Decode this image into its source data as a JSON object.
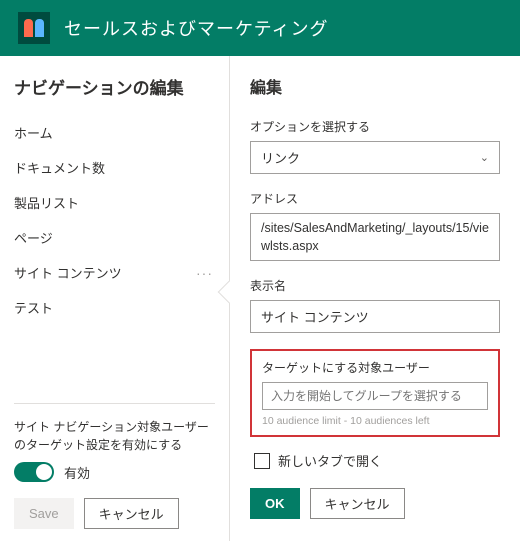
{
  "header": {
    "title": "セールスおよびマーケティング"
  },
  "left": {
    "heading": "ナビゲーションの編集",
    "items": [
      {
        "label": "ホーム"
      },
      {
        "label": "ドキュメント数"
      },
      {
        "label": "製品リスト"
      },
      {
        "label": "ページ"
      },
      {
        "label": "サイト コンテンツ"
      },
      {
        "label": "テスト"
      }
    ],
    "toggle_label": "サイト ナビゲーション対象ユーザーのターゲット設定を有効にする",
    "toggle_state": "有効",
    "save": "Save",
    "cancel": "キャンセル"
  },
  "right": {
    "heading": "編集",
    "option_label": "オプションを選択する",
    "option_value": "リンク",
    "address_label": "アドレス",
    "address_value": "/sites/SalesAndMarketing/_layouts/15/viewlsts.aspx",
    "display_label": "表示名",
    "display_value": "サイト コンテンツ",
    "target_label": "ターゲットにする対象ユーザー",
    "target_placeholder": "入力を開始してグループを選択する",
    "target_hint": "10 audience limit - 10 audiences left",
    "newtab_label": "新しいタブで開く",
    "ok": "OK",
    "cancel": "キャンセル"
  }
}
